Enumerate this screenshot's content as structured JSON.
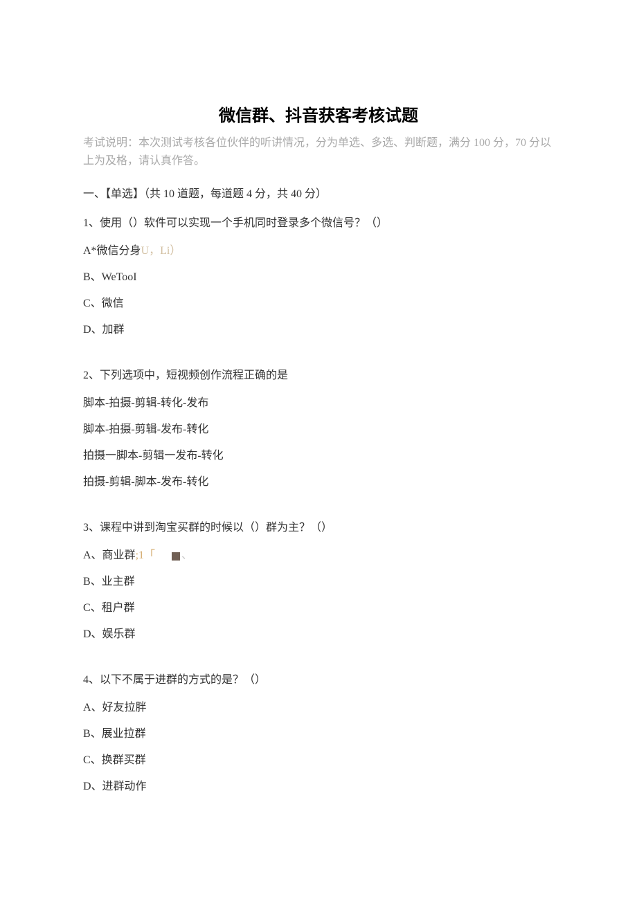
{
  "title": "微信群、抖音获客考核试题",
  "exam_note": "考试说明：本次测试考核各位伙伴的听讲情况，分为单选、多选、判断题，满分 100 分，70 分以上为及格，请认真作答。",
  "section1": {
    "heading": "一、【单选】（共 10 道题，每道题 4 分，共 40 分）",
    "q1": {
      "stem": "1、使用（）软件可以实现一个手机同时登录多个微信号？（）",
      "a_prefix": "A*微信分身",
      "a_suffix": "U，Li）",
      "b": "B、WeTooI",
      "c": "C、微信",
      "d": "D、加群"
    },
    "q2": {
      "stem": "2、下列选项中，短视频创作流程正确的是",
      "a": "脚本-拍摄-剪辑-转化-发布",
      "b": "脚本-拍摄-剪辑-发布-转化",
      "c": "拍摄一脚本-剪辑一发布-转化",
      "d": "拍摄-剪辑-脚本-发布-转化"
    },
    "q3": {
      "stem": "3、课程中讲到淘宝买群的时候以（）群为主？（）",
      "a_prefix": "A、商业群",
      "a_artifact1": ";1「",
      "a_artifact2": "、",
      "b": "B、业主群",
      "c": "C、租户群",
      "d": "D、娱乐群"
    },
    "q4": {
      "stem": "4、以下不属于进群的方式的是？（）",
      "a": "A、好友拉胖",
      "b": "B、展业拉群",
      "c": "C、换群买群",
      "d": "D、进群动作"
    }
  }
}
